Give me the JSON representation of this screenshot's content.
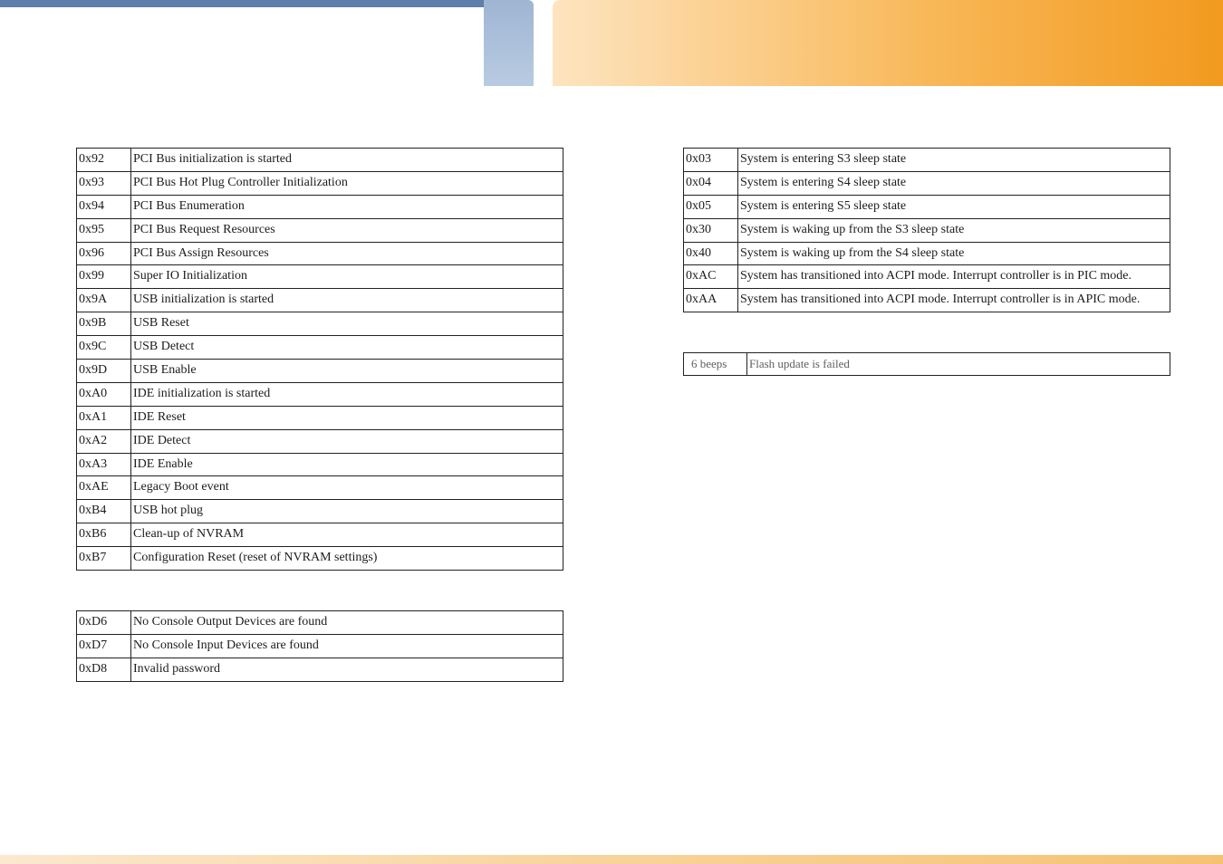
{
  "tables": {
    "left_top": [
      {
        "code": "0x92",
        "desc": "PCI Bus initialization is started"
      },
      {
        "code": "0x93",
        "desc": "PCI Bus Hot Plug Controller Initialization"
      },
      {
        "code": "0x94",
        "desc": "PCI Bus Enumeration"
      },
      {
        "code": "0x95",
        "desc": "PCI Bus Request Resources"
      },
      {
        "code": "0x96",
        "desc": "PCI Bus Assign Resources"
      },
      {
        "code": "0x99",
        "desc": "Super IO Initialization"
      },
      {
        "code": "0x9A",
        "desc": "USB initialization is started"
      },
      {
        "code": "0x9B",
        "desc": "USB Reset"
      },
      {
        "code": "0x9C",
        "desc": "USB Detect"
      },
      {
        "code": "0x9D",
        "desc": "USB Enable"
      },
      {
        "code": "0xA0",
        "desc": "IDE initialization is started"
      },
      {
        "code": "0xA1",
        "desc": "IDE Reset"
      },
      {
        "code": "0xA2",
        "desc": "IDE Detect"
      },
      {
        "code": "0xA3",
        "desc": "IDE Enable"
      },
      {
        "code": "0xAE",
        "desc": "Legacy Boot event"
      },
      {
        "code": "0xB4",
        "desc": "USB hot plug"
      },
      {
        "code": "0xB6",
        "desc": "Clean-up of NVRAM"
      },
      {
        "code": "0xB7",
        "desc": "Configuration Reset (reset of NVRAM settings)"
      }
    ],
    "left_bottom": [
      {
        "code": "0xD6",
        "desc": "No Console Output Devices are found"
      },
      {
        "code": "0xD7",
        "desc": "No Console Input Devices are found"
      },
      {
        "code": "0xD8",
        "desc": "Invalid password"
      }
    ],
    "right_top": [
      {
        "code": "0x03",
        "desc": "System is entering S3 sleep state"
      },
      {
        "code": "0x04",
        "desc": "System is entering S4 sleep state"
      },
      {
        "code": "0x05",
        "desc": "System is entering S5 sleep state"
      },
      {
        "code": "0x30",
        "desc": "System is waking up from the S3 sleep state"
      },
      {
        "code": "0x40",
        "desc": "System is waking up from the S4 sleep state"
      },
      {
        "code": "0xAC",
        "desc": "System has transitioned into ACPI mode. Interrupt controller is in PIC mode."
      },
      {
        "code": "0xAA",
        "desc": "System has transitioned into ACPI mode. Interrupt controller is in APIC mode."
      }
    ],
    "right_beep": [
      {
        "code": "6  beeps",
        "desc": "Flash update is failed"
      }
    ]
  }
}
